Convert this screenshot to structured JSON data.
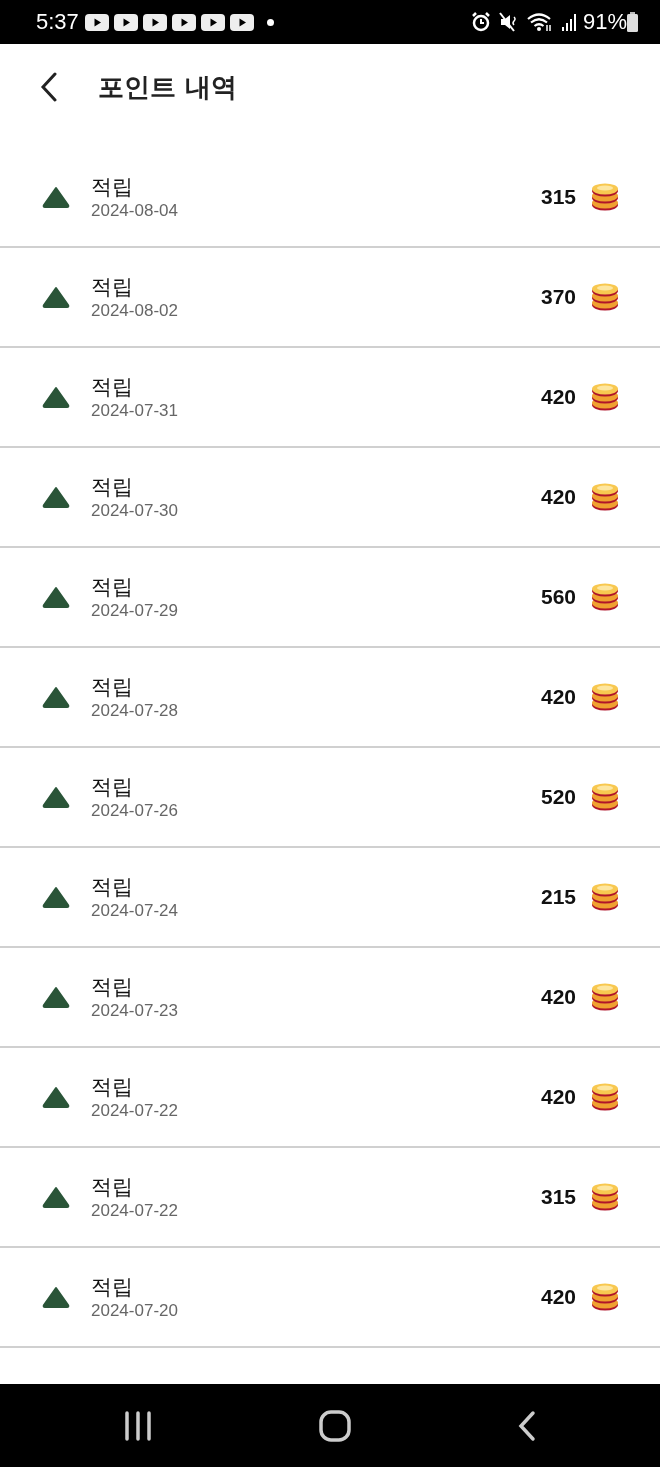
{
  "status_bar": {
    "time": "5:37",
    "notifications": [
      {
        "kind": "video"
      },
      {
        "kind": "video"
      },
      {
        "kind": "video"
      },
      {
        "kind": "video"
      },
      {
        "kind": "video"
      },
      {
        "kind": "video"
      }
    ],
    "battery": "91%"
  },
  "header": {
    "title": "포인트 내역"
  },
  "rows": [
    {
      "title": "적립",
      "date": "2024-08-04",
      "amount": "315"
    },
    {
      "title": "적립",
      "date": "2024-08-02",
      "amount": "370"
    },
    {
      "title": "적립",
      "date": "2024-07-31",
      "amount": "420"
    },
    {
      "title": "적립",
      "date": "2024-07-30",
      "amount": "420"
    },
    {
      "title": "적립",
      "date": "2024-07-29",
      "amount": "560"
    },
    {
      "title": "적립",
      "date": "2024-07-28",
      "amount": "420"
    },
    {
      "title": "적립",
      "date": "2024-07-26",
      "amount": "520"
    },
    {
      "title": "적립",
      "date": "2024-07-24",
      "amount": "215"
    },
    {
      "title": "적립",
      "date": "2024-07-23",
      "amount": "420"
    },
    {
      "title": "적립",
      "date": "2024-07-22",
      "amount": "420"
    },
    {
      "title": "적립",
      "date": "2024-07-22",
      "amount": "315"
    },
    {
      "title": "적립",
      "date": "2024-07-20",
      "amount": "420"
    }
  ]
}
